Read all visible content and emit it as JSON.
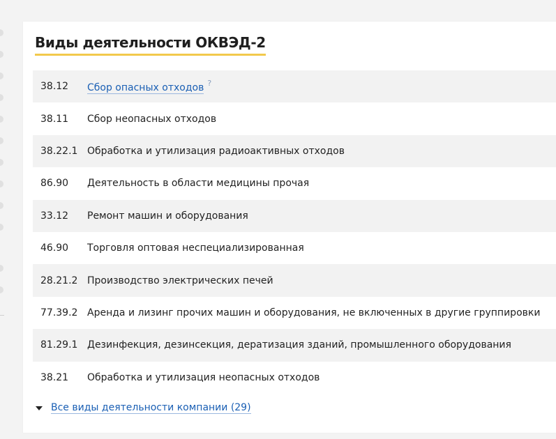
{
  "section": {
    "title": "Виды деятельности ОКВЭД-2"
  },
  "activities": [
    {
      "code": "38.12",
      "name": "Сбор опасных отходов",
      "help": "?"
    },
    {
      "code": "38.11",
      "name": "Сбор неопасных отходов"
    },
    {
      "code": "38.22.1",
      "name": "Обработка и утилизация радиоактивных отходов"
    },
    {
      "code": "86.90",
      "name": "Деятельность в области медицины прочая"
    },
    {
      "code": "33.12",
      "name": "Ремонт машин и оборудования"
    },
    {
      "code": "46.90",
      "name": "Торговля оптовая неспециализированная"
    },
    {
      "code": "28.21.2",
      "name": "Производство электрических печей"
    },
    {
      "code": "77.39.2",
      "name": "Аренда и лизинг прочих машин и оборудования, не включенных в другие группировки"
    },
    {
      "code": "81.29.1",
      "name": "Дезинфекция, дезинсекция, дератизация зданий, промышленного оборудования"
    },
    {
      "code": "38.21",
      "name": "Обработка и утилизация неопасных отходов"
    }
  ],
  "footer": {
    "all_link": "Все виды деятельности компании (29)"
  },
  "colors": {
    "link": "#1a5fb4",
    "accent_underline": "#f2c94c",
    "alt_row": "#f2f2f2"
  }
}
